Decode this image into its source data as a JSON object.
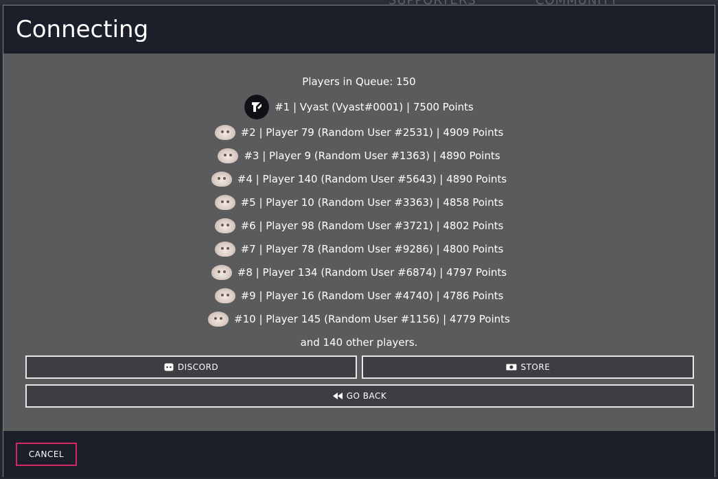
{
  "background": {
    "nav_supporters": "SUPPORTERS",
    "nav_community": "COMMUNITY"
  },
  "dialog": {
    "title": "Connecting",
    "queue_text": "Players in Queue: 150",
    "players": [
      {
        "text": "#1 | Vyast (Vyast#0001) | 7500 Points",
        "avatar": "server-logo-icon"
      },
      {
        "text": "#2 | Player 79 (Random User #2531) | 4909 Points",
        "avatar": "cat-avatar-icon"
      },
      {
        "text": "#3 | Player 9 (Random User #1363) | 4890 Points",
        "avatar": "cat-avatar-icon"
      },
      {
        "text": "#4 | Player 140 (Random User #5643) | 4890 Points",
        "avatar": "cat-avatar-icon"
      },
      {
        "text": "#5 | Player 10 (Random User #3363) | 4858 Points",
        "avatar": "cat-avatar-icon"
      },
      {
        "text": "#6 | Player 98 (Random User #3721) | 4802 Points",
        "avatar": "cat-avatar-icon"
      },
      {
        "text": "#7 | Player 78 (Random User #9286) | 4800 Points",
        "avatar": "cat-avatar-icon"
      },
      {
        "text": "#8 | Player 134 (Random User #6874) | 4797 Points",
        "avatar": "cat-avatar-icon"
      },
      {
        "text": "#9 | Player 16 (Random User #4740) | 4786 Points",
        "avatar": "cat-avatar-icon"
      },
      {
        "text": "#10 | Player 145 (Random User #1156) | 4779 Points",
        "avatar": "cat-avatar-icon"
      }
    ],
    "others_text": "and 140 other players.",
    "buttons": {
      "discord": "DISCORD",
      "store": "STORE",
      "go_back": "GO BACK"
    },
    "cancel_label": "CANCEL"
  },
  "colors": {
    "header_bg": "#1c1f2a",
    "body_bg": "#5a5b5d",
    "button_border": "#e8e8e8",
    "cancel_border": "#d62862"
  }
}
